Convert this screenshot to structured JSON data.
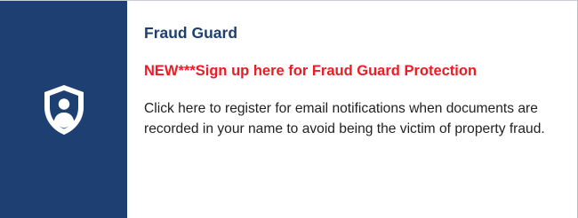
{
  "card": {
    "icon": "shield-user-icon",
    "title": "Fraud Guard",
    "promo": "NEW***Sign up here for Fraud Guard Protection",
    "description": "Click here to register for email notifications when documents are recorded in your name to avoid being the victim of property fraud."
  },
  "colors": {
    "panel": "#1d3f72",
    "title": "#1d3f72",
    "promo": "#f01a24",
    "text": "#222222"
  }
}
